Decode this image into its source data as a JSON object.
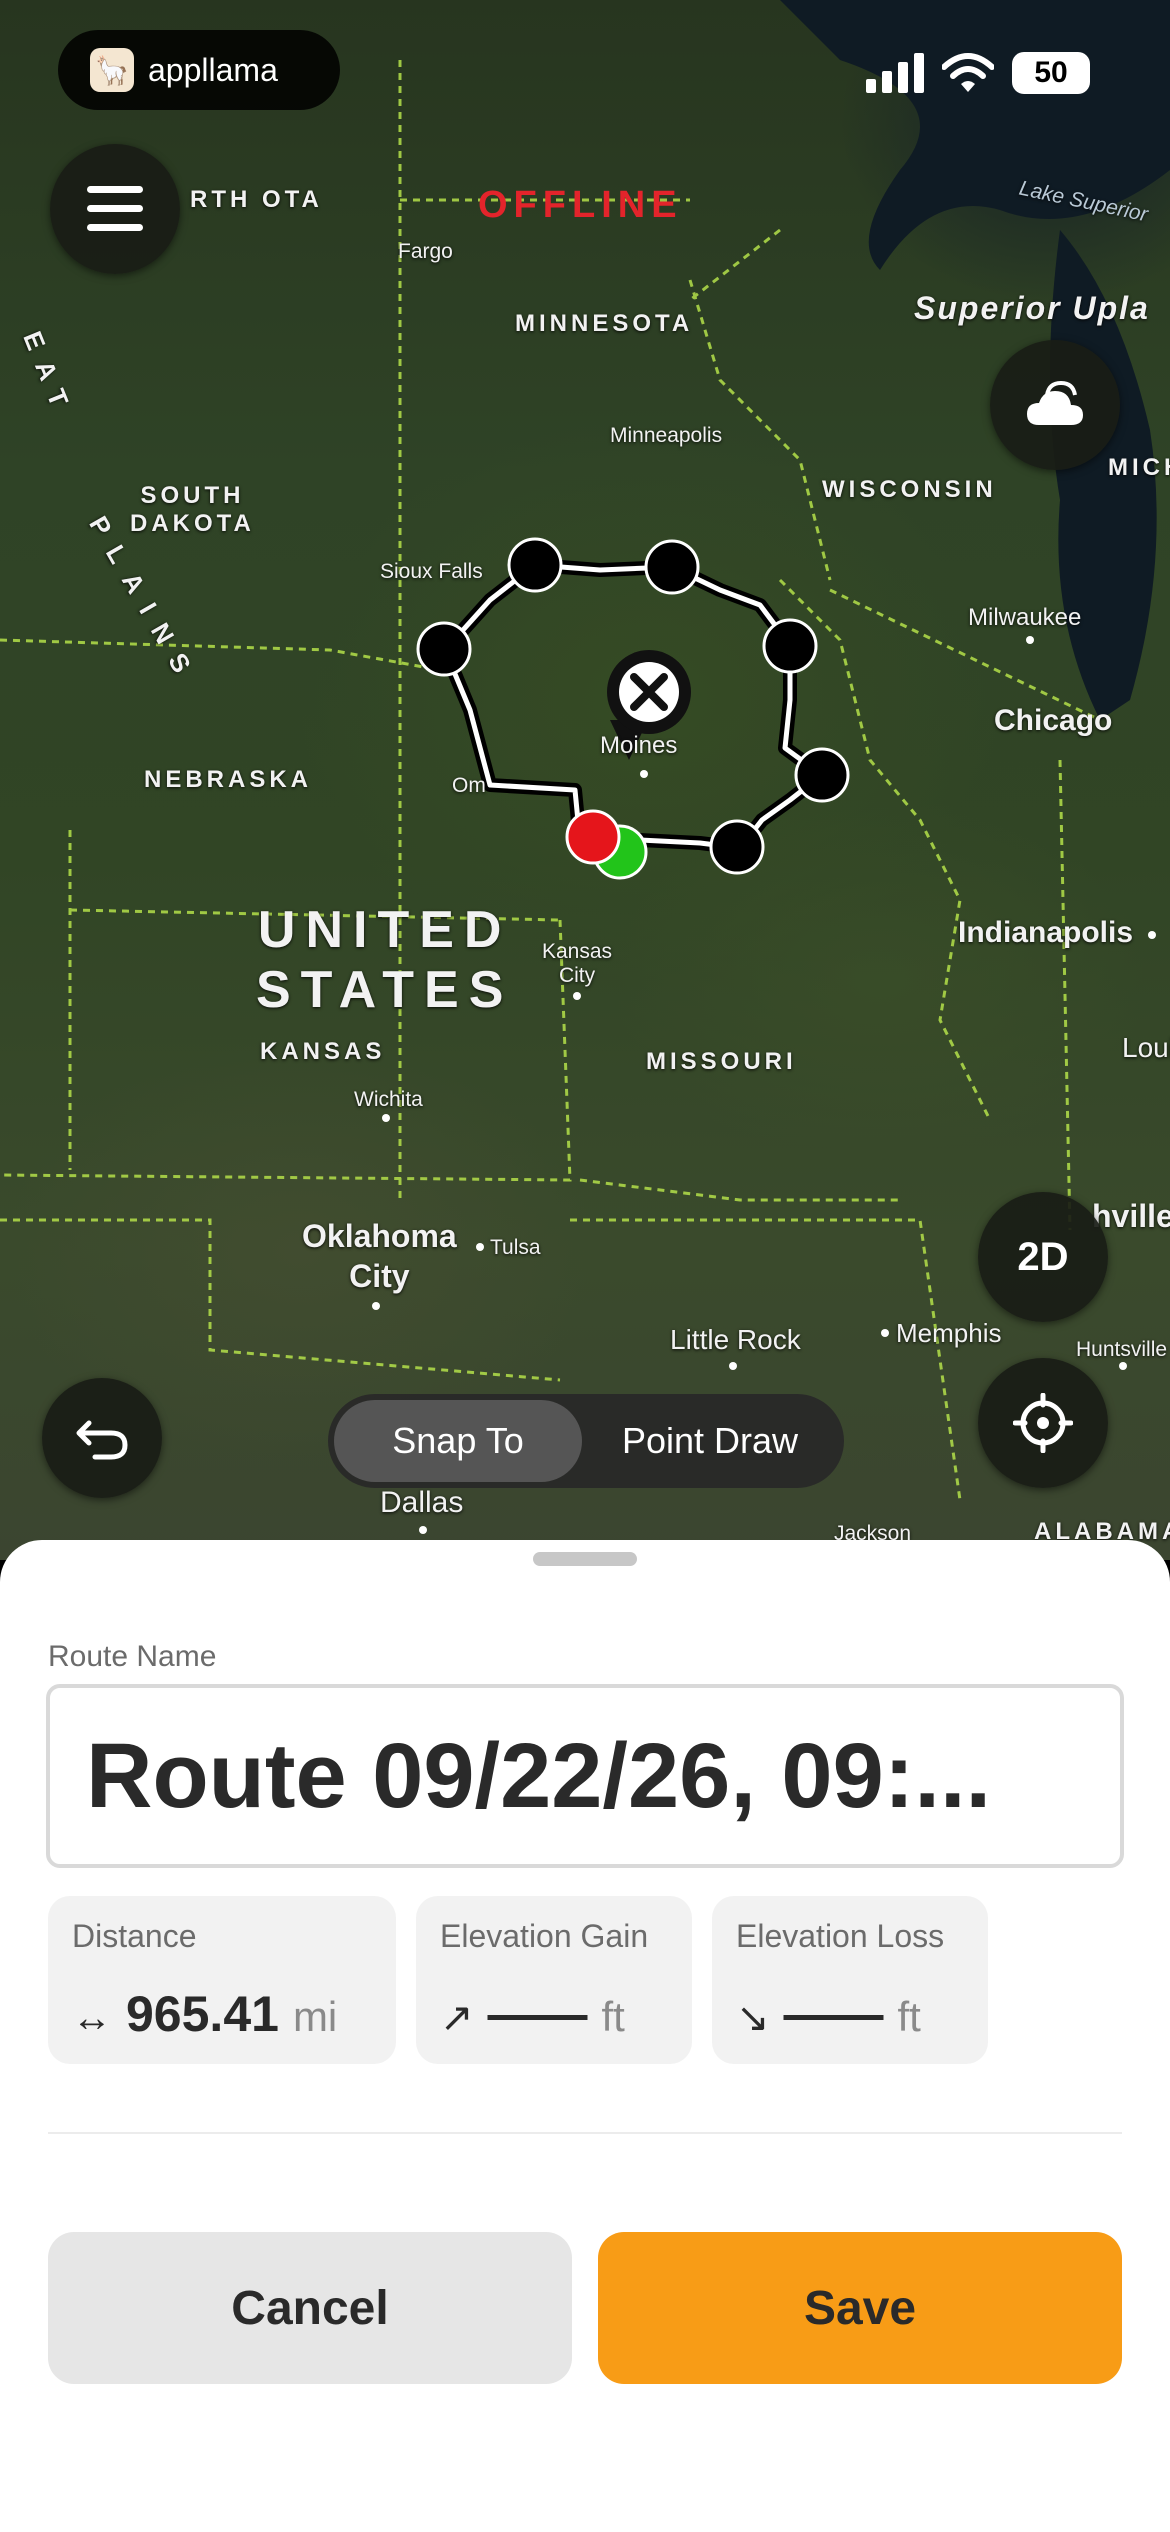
{
  "status_bar": {
    "app_name": "appllama",
    "battery": "50"
  },
  "map": {
    "offline_label": "OFFLINE",
    "labels": {
      "north_dakota": "RTH\nOTA",
      "fargo": "Fargo",
      "minnesota": "MINNESOTA",
      "minneapolis": "Minneapolis",
      "lake_superior": "Lake Superior",
      "superior_upland": "Superior Upla",
      "wisconsin": "WISCONSIN",
      "mich": "MICH",
      "south_dakota": "SOUTH\nDAKOTA",
      "sioux_falls": "Sioux Falls",
      "great_plains_a": "EAT",
      "great_plains_b": "PLAINS",
      "milwaukee": "Milwaukee",
      "chicago": "Chicago",
      "des_moines": "Moines",
      "omaha": "Om",
      "nebraska": "NEBRASKA",
      "united_states": "UNITED\nSTATES",
      "kansas_city": "Kansas\nCity",
      "indianapolis": "Indianapolis",
      "kansas": "KANSAS",
      "wichita": "Wichita",
      "missouri": "MISSOURI",
      "louisville": "Loui",
      "oklahoma_city": "Oklahoma\nCity",
      "tulsa": "Tulsa",
      "nashville": "hville",
      "little_rock": "Little Rock",
      "memphis": "Memphis",
      "huntsville": "Huntsville",
      "dallas": "Dallas",
      "jackson": "Jackson",
      "alabama": "ALABAMA"
    },
    "view_mode": "2D",
    "segmented": {
      "snap_to": "Snap To",
      "point_draw": "Point Draw"
    }
  },
  "sheet": {
    "route_name_label": "Route Name",
    "route_name_value": "Route 09/22/26, 09:...",
    "stats": [
      {
        "label": "Distance",
        "icon": "↔",
        "value": "965.41",
        "unit": "mi"
      },
      {
        "label": "Elevation Gain",
        "icon": "↗",
        "value": "——",
        "unit": "ft"
      },
      {
        "label": "Elevation Loss",
        "icon": "↘",
        "value": "——",
        "unit": "ft"
      }
    ],
    "cancel_label": "Cancel",
    "save_label": "Save"
  },
  "colors": {
    "accent": "#f89c16",
    "offline": "#e3242b",
    "start_point": "#22c41a",
    "end_point": "#e5151b"
  }
}
